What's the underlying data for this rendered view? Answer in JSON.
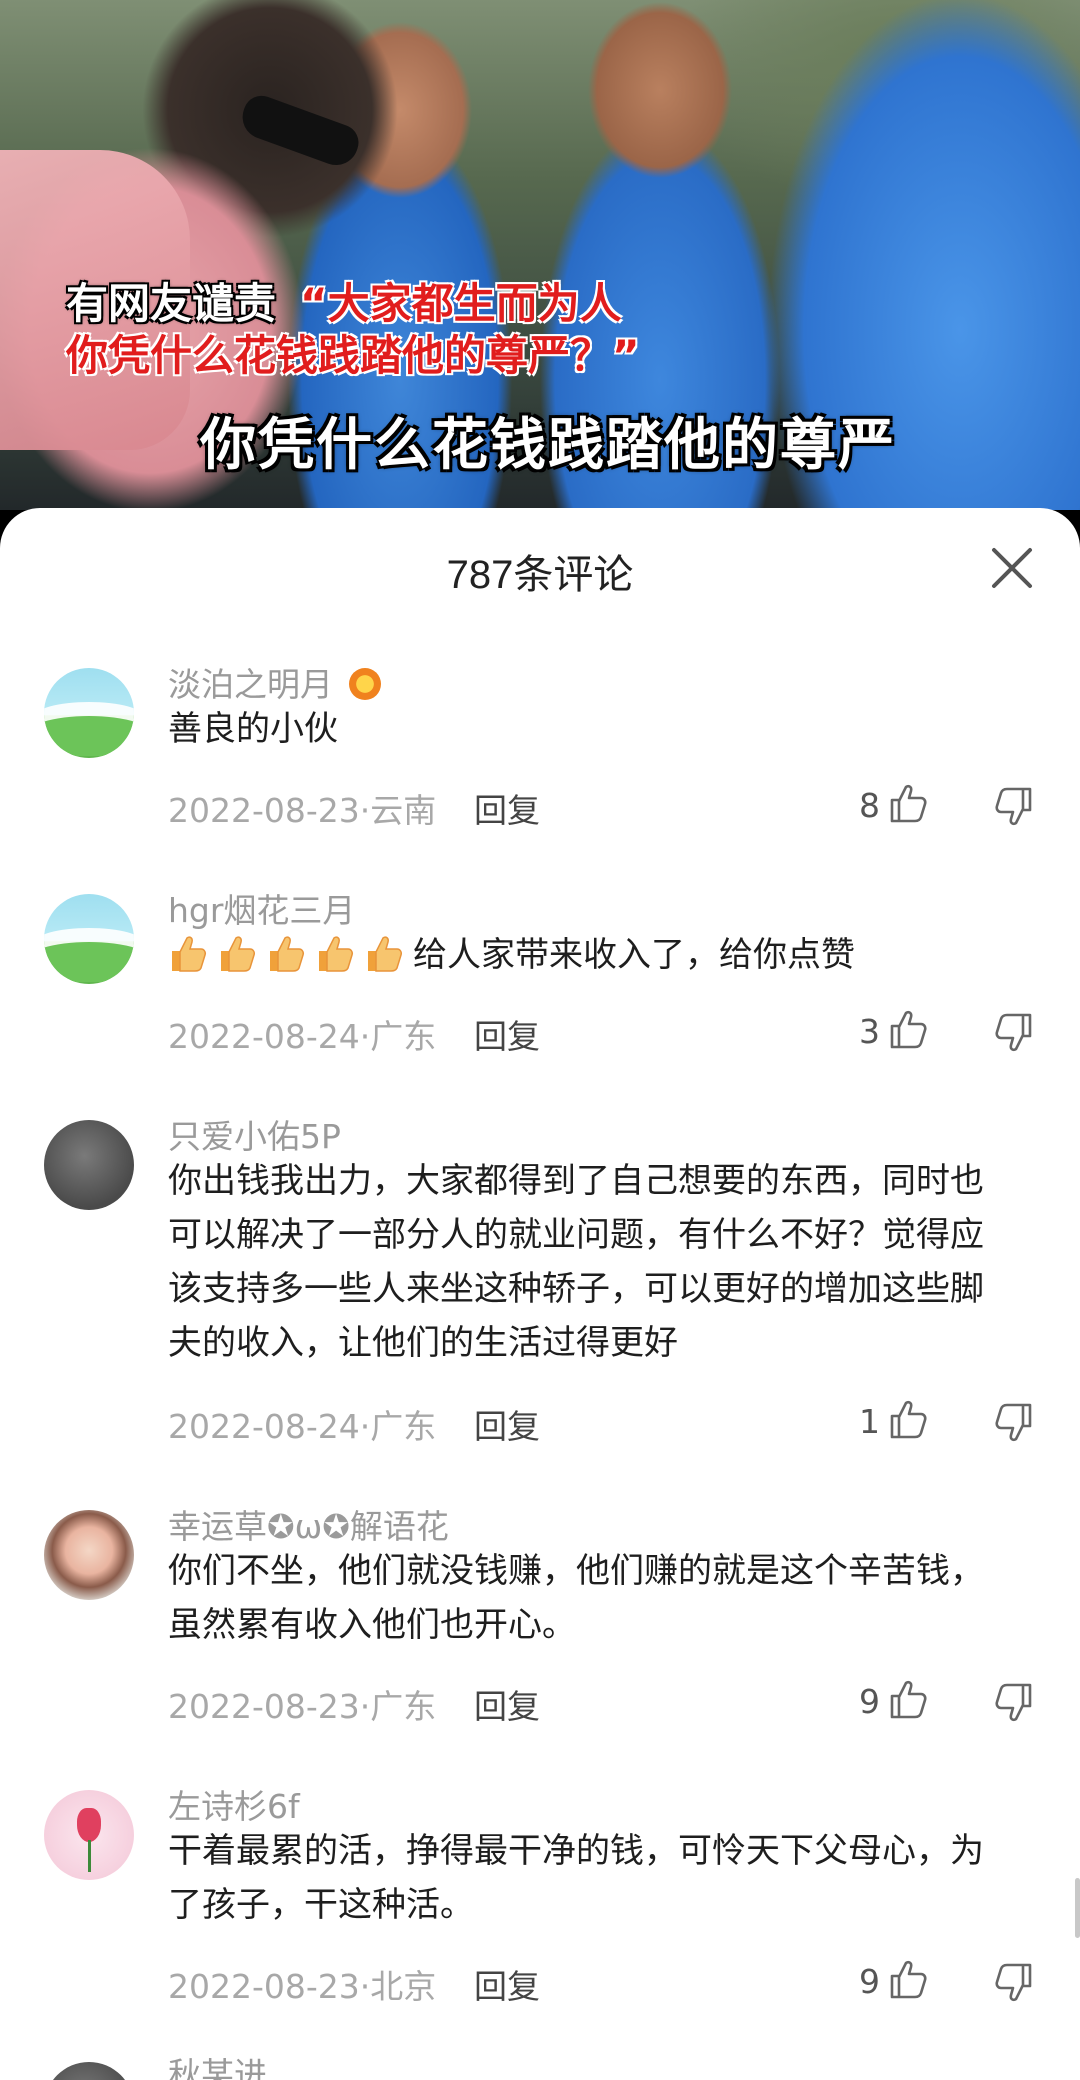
{
  "video": {
    "caption_prefix": "有网友谴责",
    "caption_quote_line1": "“大家都生而为人",
    "caption_quote_line2": "你凭什么花钱践踏他的尊严？”",
    "subtitle": "你凭什么花钱践踏他的尊严"
  },
  "comments_panel": {
    "title": "787条评论",
    "close_icon": "close-icon",
    "reply_label": "回复",
    "comments": [
      {
        "username": "淡泊之明月",
        "avatar": "landscape-avatar",
        "badge": "fan-badge-icon",
        "lines": [
          "善良的小伙"
        ],
        "meta": "2022-08-23·云南",
        "likes": "8"
      },
      {
        "username": "hgr烟花三月",
        "avatar": "landscape-avatar",
        "emojis": [
          "thumbs-up-emoji",
          "thumbs-up-emoji",
          "thumbs-up-emoji",
          "thumbs-up-emoji",
          "thumbs-up-emoji"
        ],
        "lines": [
          "给人家带来收入了，给你点赞"
        ],
        "meta": "2022-08-24·广东",
        "likes": "3"
      },
      {
        "username": "只爱小佑5P",
        "avatar": "gray-avatar",
        "lines": [
          "你出钱我出力，大家都得到了自己想要的东西，同时也",
          "可以解决了一部分人的就业问题，有什么不好？觉得应",
          "该支持多一些人来坐这种轿子，可以更好的增加这些脚",
          "夫的收入，让他们的生活过得更好"
        ],
        "meta": "2022-08-24·广东",
        "likes": "1"
      },
      {
        "username": "幸运草✪ω✪解语花",
        "avatar": "photo-avatar",
        "lines": [
          "你们不坐，他们就没钱赚，他们赚的就是这个辛苦钱，",
          "虽然累有收入他们也开心。"
        ],
        "meta": "2022-08-23·广东",
        "likes": "9"
      },
      {
        "username": "左诗杉6f",
        "avatar": "tulip-avatar",
        "lines": [
          "干着最累的活，挣得最干净的钱，可怜天下父母心，为",
          "了孩子，干这种活。"
        ],
        "meta": "2022-08-23·北京",
        "likes": "9"
      }
    ],
    "partial_username": "秋某进"
  },
  "colors": {
    "caption_red": "#e11d1d",
    "sheet_background": "#ffffff",
    "meta_gray": "#a8a8a8"
  }
}
